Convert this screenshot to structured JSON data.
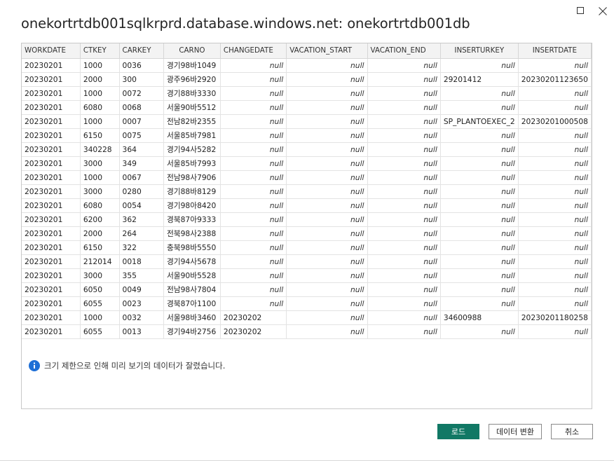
{
  "dialog": {
    "title": "onekortrtdb001sqlkrprd.database.windows.net: onekortrtdb001db",
    "icons": {
      "maximize": "maximize-icon",
      "close": "close-icon",
      "info": "info-icon"
    }
  },
  "table": {
    "columns": [
      "WORKDATE",
      "CTKEY",
      "CARKEY",
      "CARNO",
      "CHANGEDATE",
      "VACATION_START",
      "VACATION_END",
      "INSERTURKEY",
      "INSERTDATE"
    ],
    "rows": [
      [
        "20230201",
        "1000",
        "0036",
        "경기98바1049",
        "null",
        "null",
        "null",
        "null",
        "null"
      ],
      [
        "20230201",
        "2000",
        "300",
        "광주96바2920",
        "null",
        "null",
        "null",
        "29201412",
        "20230201123650"
      ],
      [
        "20230201",
        "1000",
        "0072",
        "경기88바3330",
        "null",
        "null",
        "null",
        "null",
        "null"
      ],
      [
        "20230201",
        "6080",
        "0068",
        "서울90바5512",
        "null",
        "null",
        "null",
        "null",
        "null"
      ],
      [
        "20230201",
        "1000",
        "0007",
        "전남82바2355",
        "null",
        "null",
        "null",
        "SP_PLANTOEXEC_2",
        "20230201000508"
      ],
      [
        "20230201",
        "6150",
        "0075",
        "서울85바7981",
        "null",
        "null",
        "null",
        "null",
        "null"
      ],
      [
        "20230201",
        "340228",
        "364",
        "경기94사5282",
        "null",
        "null",
        "null",
        "null",
        "null"
      ],
      [
        "20230201",
        "3000",
        "349",
        "서울85바7993",
        "null",
        "null",
        "null",
        "null",
        "null"
      ],
      [
        "20230201",
        "1000",
        "0067",
        "전남98사7906",
        "null",
        "null",
        "null",
        "null",
        "null"
      ],
      [
        "20230201",
        "3000",
        "0280",
        "경기88바8129",
        "null",
        "null",
        "null",
        "null",
        "null"
      ],
      [
        "20230201",
        "6080",
        "0054",
        "경기98아8420",
        "null",
        "null",
        "null",
        "null",
        "null"
      ],
      [
        "20230201",
        "6200",
        "362",
        "경북87아9333",
        "null",
        "null",
        "null",
        "null",
        "null"
      ],
      [
        "20230201",
        "2000",
        "264",
        "전북98사2388",
        "null",
        "null",
        "null",
        "null",
        "null"
      ],
      [
        "20230201",
        "6150",
        "322",
        "충북98바5550",
        "null",
        "null",
        "null",
        "null",
        "null"
      ],
      [
        "20230201",
        "212014",
        "0018",
        "경기94사5678",
        "null",
        "null",
        "null",
        "null",
        "null"
      ],
      [
        "20230201",
        "3000",
        "355",
        "서울90바5528",
        "null",
        "null",
        "null",
        "null",
        "null"
      ],
      [
        "20230201",
        "6050",
        "0049",
        "전남98사7804",
        "null",
        "null",
        "null",
        "null",
        "null"
      ],
      [
        "20230201",
        "6055",
        "0023",
        "경북87아1100",
        "null",
        "null",
        "null",
        "null",
        "null"
      ],
      [
        "20230201",
        "1000",
        "0032",
        "서울98바3460",
        "20230202",
        "null",
        "null",
        "34600988",
        "20230201180258"
      ],
      [
        "20230201",
        "6055",
        "0013",
        "경기94바2756",
        "20230202",
        "null",
        "null",
        "null",
        "null"
      ]
    ]
  },
  "info": {
    "message": "크기 제한으로 인해 미리 보기의 데이터가 잘렸습니다."
  },
  "buttons": {
    "load": "로드",
    "transform": "데이터 변환",
    "cancel": "취소"
  },
  "colors": {
    "primary": "#117865",
    "header_bg": "#f3f3f3",
    "info": "#1e6fd6"
  }
}
